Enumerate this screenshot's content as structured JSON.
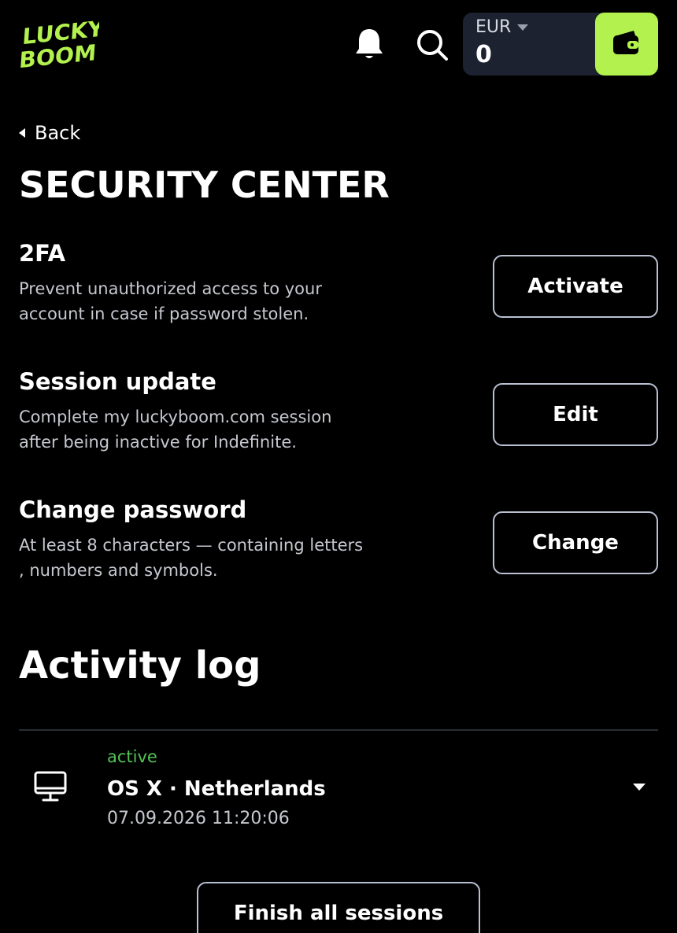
{
  "header": {
    "logo_line1": "LUCKY",
    "logo_line2": "BOOM",
    "logo_color": "#b3f24e",
    "currency": "EUR",
    "balance": "0",
    "accent_color": "#b3f24e",
    "icons": [
      "bell-icon",
      "search-icon",
      "wallet-icon"
    ]
  },
  "nav": {
    "back_label": "Back"
  },
  "page_title": "SECURITY CENTER",
  "sections": {
    "two_fa": {
      "title": "2FA",
      "description": "Prevent unauthorized access to your account in case if password stolen.",
      "button": "Activate"
    },
    "session": {
      "title": "Session update",
      "description": "Complete my luckyboom.com session after being inactive for  Indefinite.",
      "button": "Edit"
    },
    "password": {
      "title": "Change password",
      "description": "At least 8 characters — containing letters , numbers and symbols.",
      "button": "Change"
    }
  },
  "activity": {
    "title": "Activity log",
    "sessions": [
      {
        "status": "active",
        "status_color": "#53c155",
        "device": "OS X · Netherlands",
        "timestamp": "07.09.2026 11:20:06"
      }
    ],
    "finish_button": "Finish all sessions"
  }
}
